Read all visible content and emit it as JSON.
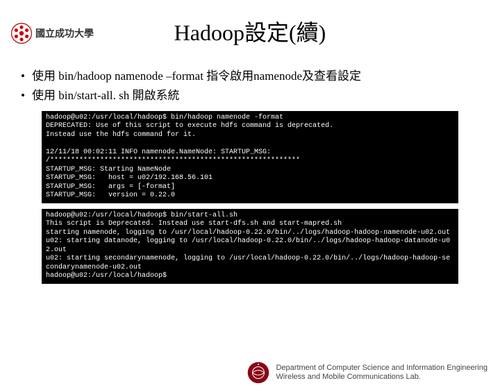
{
  "logo": {
    "university": "國立成功大學"
  },
  "title": "Hadoop設定(續)",
  "bullets": [
    "使用 bin/hadoop namenode –format 指令啟用namenode及查看設定",
    "使用 bin/start-all. sh 開啟系統"
  ],
  "terminal1": [
    "hadoop@u02:/usr/local/hadoop$ bin/hadoop namenode -format",
    "DEPRECATED: Use of this script to execute hdfs command is deprecated.",
    "Instead use the hdfs command for it.",
    "",
    "12/11/18 00:02:11 INFO namenode.NameNode: STARTUP_MSG:",
    "/************************************************************",
    "STARTUP_MSG: Starting NameNode",
    "STARTUP_MSG:   host = u02/192.168.56.101",
    "STARTUP_MSG:   args = [-format]",
    "STARTUP_MSG:   version = 0.22.0"
  ],
  "terminal2": [
    "hadoop@u02:/usr/local/hadoop$ bin/start-all.sh",
    "This script is Deprecated. Instead use start-dfs.sh and start-mapred.sh",
    "starting namenode, logging to /usr/local/hadoop-0.22.0/bin/../logs/hadoop-hadoop-namenode-u02.out",
    "u02: starting datanode, logging to /usr/local/hadoop-0.22.0/bin/../logs/hadoop-hadoop-datanode-u02.out",
    "u02: starting secondarynamenode, logging to /usr/local/hadoop-0.22.0/bin/../logs/hadoop-hadoop-secondarynamenode-u02.out",
    "hadoop@u02:/usr/local/hadoop$"
  ],
  "footer": {
    "line1": "Department of Computer Science and Information Engineering",
    "line2": "Wireless and Mobile Communications Lab."
  }
}
